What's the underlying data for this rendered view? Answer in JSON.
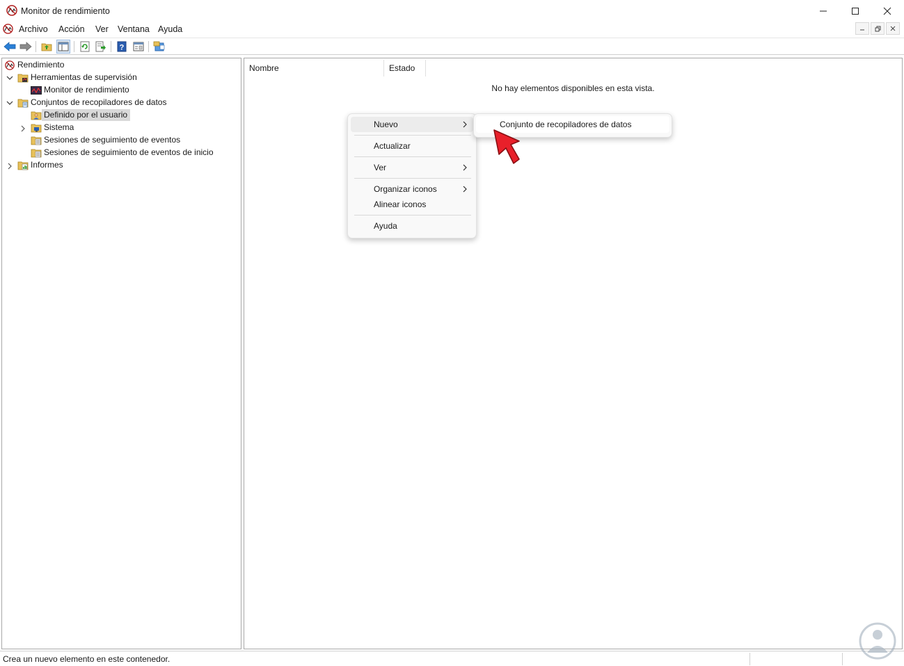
{
  "window": {
    "title": "Monitor de rendimiento"
  },
  "menubar": {
    "items": [
      "Archivo",
      "Acción",
      "Ver",
      "Ventana",
      "Ayuda"
    ]
  },
  "toolbar": {
    "icons": [
      "back-icon",
      "forward-icon",
      "up-folder-icon",
      "show-hide-tree-icon",
      "refresh-icon",
      "export-icon",
      "help-icon",
      "properties-icon",
      "mmc-icon"
    ]
  },
  "tree": {
    "root": "Rendimiento",
    "monitoring_tools": "Herramientas de supervisión",
    "perf_monitor": "Monitor de rendimiento",
    "collector_sets": "Conjuntos de recopiladores de datos",
    "user_defined": "Definido por el usuario",
    "system": "Sistema",
    "event_trace": "Sesiones de seguimiento de eventos",
    "startup_trace": "Sesiones de seguimiento de eventos de inicio",
    "reports": "Informes"
  },
  "list": {
    "columns": [
      "Nombre",
      "Estado"
    ],
    "empty_message": "No hay elementos disponibles en esta vista."
  },
  "context_menu": {
    "nuevo": "Nuevo",
    "actualizar": "Actualizar",
    "ver": "Ver",
    "organizar": "Organizar iconos",
    "alinear": "Alinear iconos",
    "ayuda": "Ayuda"
  },
  "submenu": {
    "item": "Conjunto de recopiladores de datos"
  },
  "status": {
    "text": "Crea un nuevo elemento en este contenedor."
  },
  "colors": {
    "accent_arrow": "#e8202a",
    "selection": "#d9d9d9"
  }
}
